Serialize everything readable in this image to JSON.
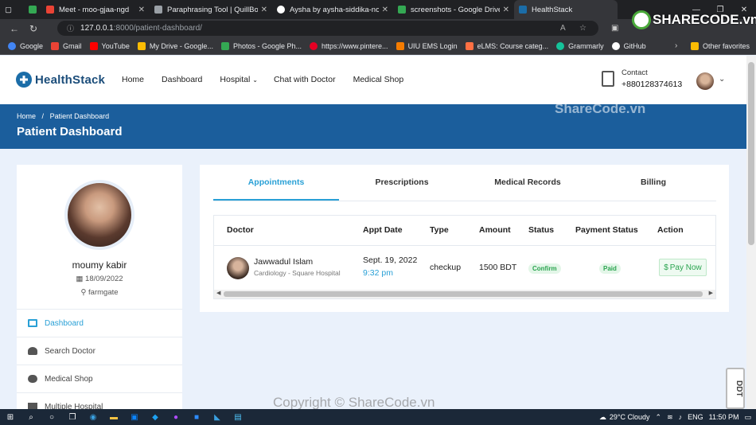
{
  "browser": {
    "tabs": [
      {
        "title": "Meet - moo-gjaa-ngd",
        "color": "#ea4335"
      },
      {
        "title": "Paraphrasing Tool | QuillBot AI",
        "color": "#9aa0a6"
      },
      {
        "title": "Aysha by aysha-siddika-nowshin",
        "color": "#ffffff"
      },
      {
        "title": "screenshots - Google Drive",
        "color": "#34a853"
      },
      {
        "title": "HealthStack",
        "color": "#1b6da8"
      }
    ],
    "url_host": "127.0.0.1",
    "url_path": ":8000/patient-dashboard/",
    "bookmarks": [
      {
        "label": "Google",
        "color": "#4285f4"
      },
      {
        "label": "Gmail",
        "color": "#ea4335"
      },
      {
        "label": "YouTube",
        "color": "#ff0000"
      },
      {
        "label": "My Drive - Google...",
        "color": "#fbbc04"
      },
      {
        "label": "Photos - Google Ph...",
        "color": "#34a853"
      },
      {
        "label": "https://www.pintere...",
        "color": "#e60023"
      },
      {
        "label": "UIU EMS Login",
        "color": "#f57c00"
      },
      {
        "label": "eLMS: Course categ...",
        "color": "#ff7043"
      },
      {
        "label": "Grammarly",
        "color": "#15c39a"
      },
      {
        "label": "GitHub",
        "color": "#ffffff"
      }
    ],
    "other_favorites": "Other favorites"
  },
  "header": {
    "brand": "HealthStack",
    "nav": [
      "Home",
      "Dashboard",
      "Hospital",
      "Chat with Doctor",
      "Medical Shop"
    ],
    "contact_label": "Contact",
    "contact_phone": "+880128374613"
  },
  "banner": {
    "crumb_home": "Home",
    "crumb_sep": "/",
    "crumb_current": "Patient Dashboard",
    "title": "Patient Dashboard"
  },
  "profile": {
    "name": "moumy kabir",
    "dob": "18/09/2022",
    "location": "farmgate",
    "menu": [
      "Dashboard",
      "Search Doctor",
      "Medical Shop",
      "Multiple Hospital"
    ]
  },
  "dashboard": {
    "tabs": [
      "Appointments",
      "Prescriptions",
      "Medical Records",
      "Billing"
    ],
    "columns": [
      "Doctor",
      "Appt Date",
      "Type",
      "Amount",
      "Status",
      "Payment Status",
      "Action"
    ],
    "rows": [
      {
        "doctor": "Jawwadul Islam",
        "doctor_sub": "Cardiology - Square Hospital",
        "date": "Sept. 19, 2022",
        "time": "9:32 pm",
        "type": "checkup",
        "amount": "1500 BDT",
        "status": "Confirm",
        "payment": "Paid",
        "action": "Pay Now"
      }
    ]
  },
  "overlay": {
    "sharecode_logo": "SHARECODE.vn",
    "watermark": "ShareCode.vn",
    "copyright": "Copyright © ShareCode.vn",
    "ddt": "DDT"
  },
  "taskbar": {
    "weather": "29°C  Cloudy",
    "lang": "ENG",
    "time": "11:50 PM"
  },
  "colors": {
    "accent": "#29a0d6",
    "banner": "#1b5e9c",
    "success": "#2aa44f"
  }
}
